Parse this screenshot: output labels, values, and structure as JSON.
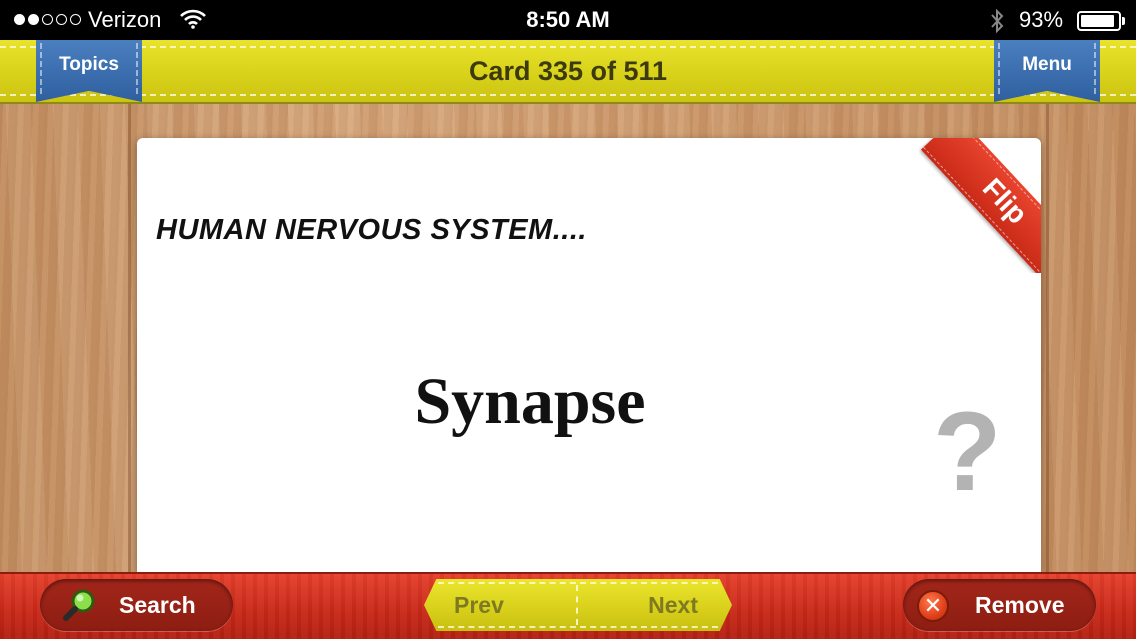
{
  "status_bar": {
    "signal_bars_filled": 2,
    "signal_bars_total": 5,
    "carrier": "Verizon",
    "time": "8:50 AM",
    "battery_percent": "93%",
    "battery_level": 0.93,
    "icons": [
      "wifi-icon",
      "bluetooth-icon",
      "battery-icon"
    ]
  },
  "header": {
    "title": "Card 335 of 511",
    "topics_label": "Topics",
    "menu_label": "Menu",
    "color": "#d9d21b",
    "ribbon_color": "#3a6cae"
  },
  "card": {
    "topic": "HUMAN NERVOUS SYSTEM....",
    "term": "Synapse",
    "hint_symbol": "?",
    "flip_label": "Flip",
    "flip_color": "#d8351f"
  },
  "toolbar": {
    "search_label": "Search",
    "prev_label": "Prev",
    "next_label": "Next",
    "remove_label": "Remove",
    "remove_symbol": "✕",
    "color": "#c82818"
  }
}
